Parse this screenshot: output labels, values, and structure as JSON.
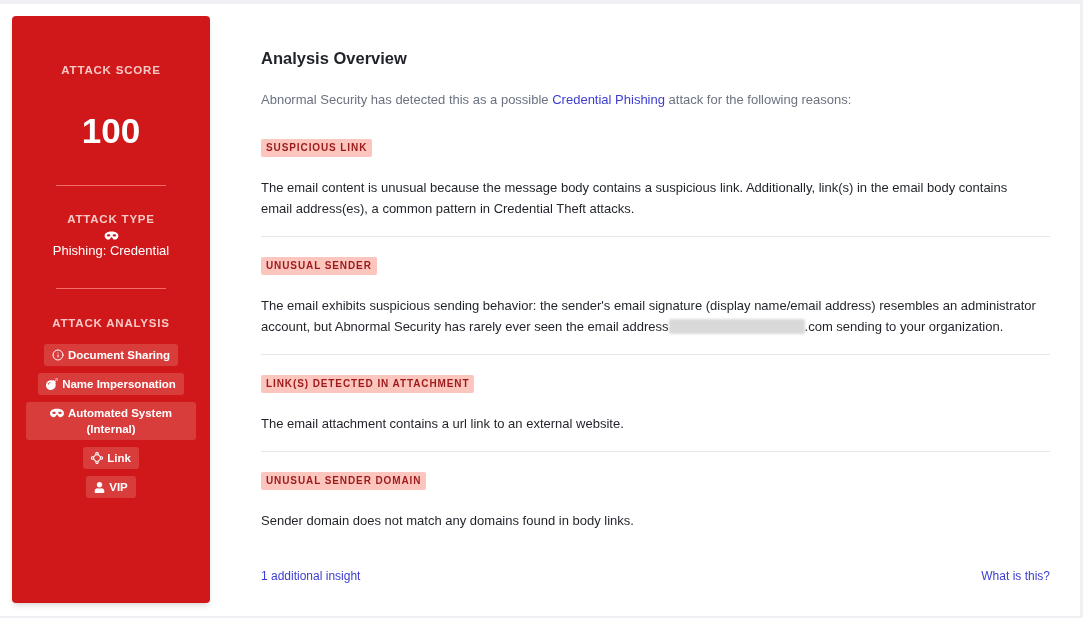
{
  "sidebar": {
    "score": {
      "label": "ATTACK SCORE",
      "value": "100"
    },
    "attack_type": {
      "label": "ATTACK TYPE",
      "value": "Phishing: Credential"
    },
    "attack_analysis": {
      "label": "ATTACK ANALYSIS",
      "tags": [
        {
          "kind": "info",
          "label": "Document Sharing"
        },
        {
          "kind": "bomb",
          "label": "Name Impersonation"
        },
        {
          "kind": "mask",
          "label": "Automated System (Internal)"
        },
        {
          "kind": "nodes",
          "label": "Link"
        },
        {
          "kind": "user",
          "label": "VIP"
        }
      ]
    }
  },
  "overview": {
    "title": "Analysis Overview",
    "intro": {
      "before": "Abnormal Security has detected this as a possible ",
      "link": "Credential Phishing",
      "after": " attack for the following reasons:"
    },
    "reasons": [
      {
        "tag": "SUSPICIOUS LINK",
        "segments": [
          {
            "kind": "text",
            "text": "The email content is unusual because the message body contains a suspicious link. Additionally, link(s) in the email body contains email address(es), a common pattern in Credential Theft attacks."
          }
        ]
      },
      {
        "tag": "UNUSUAL SENDER",
        "segments": [
          {
            "kind": "text",
            "text": "The email exhibits suspicious sending behavior: the sender's email signature (display name/email address) resembles an administrator account, but Abnormal Security has rarely ever seen the email address"
          },
          {
            "kind": "redacted"
          },
          {
            "kind": "text",
            "text": ".com sending to your organization."
          }
        ]
      },
      {
        "tag": "LINK(S) DETECTED IN ATTACHMENT",
        "segments": [
          {
            "kind": "text",
            "text": "The email attachment contains a url link to an external website."
          }
        ]
      },
      {
        "tag": "UNUSUAL SENDER DOMAIN",
        "segments": [
          {
            "kind": "text",
            "text": "Sender domain does not match any domains found in body links."
          }
        ]
      }
    ],
    "footer": {
      "insights_link": "1 additional insight",
      "help_link": "What is this?"
    }
  }
}
